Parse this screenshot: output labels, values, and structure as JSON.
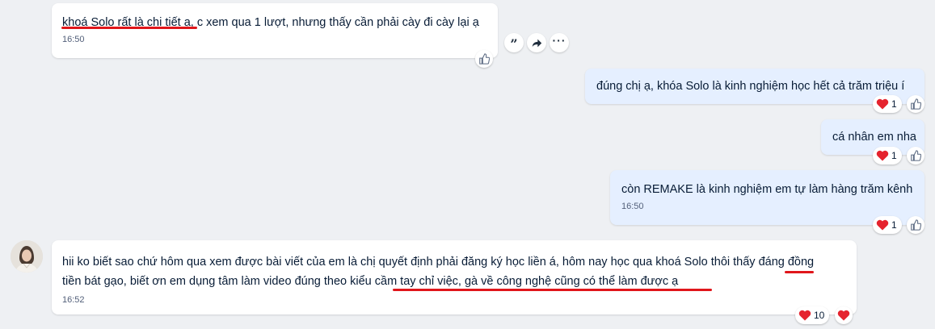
{
  "messages": [
    {
      "text": "khoá Solo rất là chi tiết ạ, c xem qua 1 lượt, nhưng thấy cần phải cày đi cày lại ạ",
      "time": "16:50"
    },
    {
      "text": "đúng chị ạ, khóa Solo là kinh nghiệm học hết cả trăm triệu í",
      "reaction_count": "1"
    },
    {
      "text": "cá nhân em nha",
      "reaction_count": "1"
    },
    {
      "text": "còn REMAKE là kinh nghiệm em tự làm hàng trăm kênh",
      "time": "16:50",
      "reaction_count": "1"
    },
    {
      "line1": "hii ko biết sao chứ hôm qua xem được bài viết của em là chị quyết định phải đăng ký học liền á, hôm nay học qua khoá Solo thôi thấy đáng đồng",
      "line2": "tiền bát gạo, biết ơn em dụng tâm làm video đúng theo kiểu cầm tay chỉ việc, gà về công nghệ cũng có thể làm được ạ",
      "time": "16:52",
      "reaction_count": "10"
    }
  ],
  "actions": {
    "quote_icon": "quote-icon",
    "forward_icon": "share-icon",
    "more_icon": "more-icon"
  },
  "colors": {
    "incoming": "#ffffff",
    "outgoing": "#e5efff",
    "heart": "#e5232e",
    "annotation": "#e0161b",
    "background": "#eef0f3"
  }
}
